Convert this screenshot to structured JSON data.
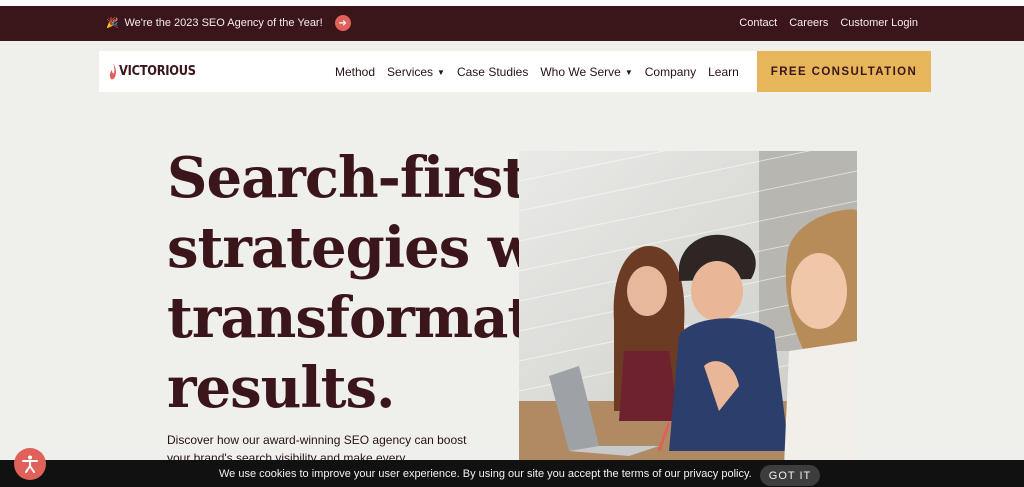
{
  "topbar": {
    "announcement": "We're the 2023 SEO Agency of the Year!",
    "links": [
      "Contact",
      "Careers",
      "Customer Login"
    ]
  },
  "nav": {
    "logo_text": "VICTORIOUS",
    "items": [
      "Method",
      "Services",
      "Case Studies",
      "Who We Serve",
      "Company",
      "Learn"
    ],
    "cta_label": "FREE CONSULTATION"
  },
  "hero": {
    "headline_lines": [
      "Search-first",
      "strategies with",
      "transformative",
      "results."
    ],
    "description": "Discover how our award-winning SEO agency can boost your brand's search visibility and make every"
  },
  "cookie": {
    "message": "We use cookies to improve your user experience. By using our site you accept the terms of our privacy policy.",
    "button_label": "GOT IT"
  },
  "colors": {
    "brand_dark": "#3a1519",
    "accent_coral": "#e0605a",
    "cta_gold": "#e8b65a",
    "hero_bg": "#efefec"
  },
  "icons": [
    "party-icon",
    "arrow-right-icon",
    "chevron-down-icon",
    "logo-flame-icon",
    "accessibility-icon"
  ]
}
